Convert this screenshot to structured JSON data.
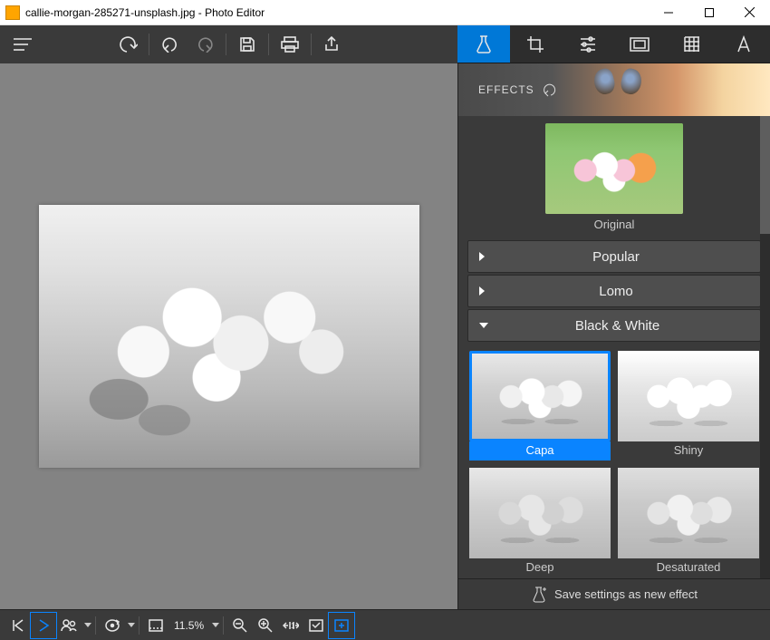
{
  "window": {
    "title": "callie-morgan-285271-unsplash.jpg - Photo Editor"
  },
  "panel": {
    "header": "EFFECTS",
    "original_label": "Original",
    "categories": {
      "popular": "Popular",
      "lomo": "Lomo",
      "bw": "Black & White"
    },
    "effects": {
      "capa": "Capa",
      "shiny": "Shiny",
      "deep": "Deep",
      "desaturated": "Desaturated"
    },
    "save_label": "Save settings as new effect"
  },
  "status": {
    "zoom": "11.5%"
  }
}
